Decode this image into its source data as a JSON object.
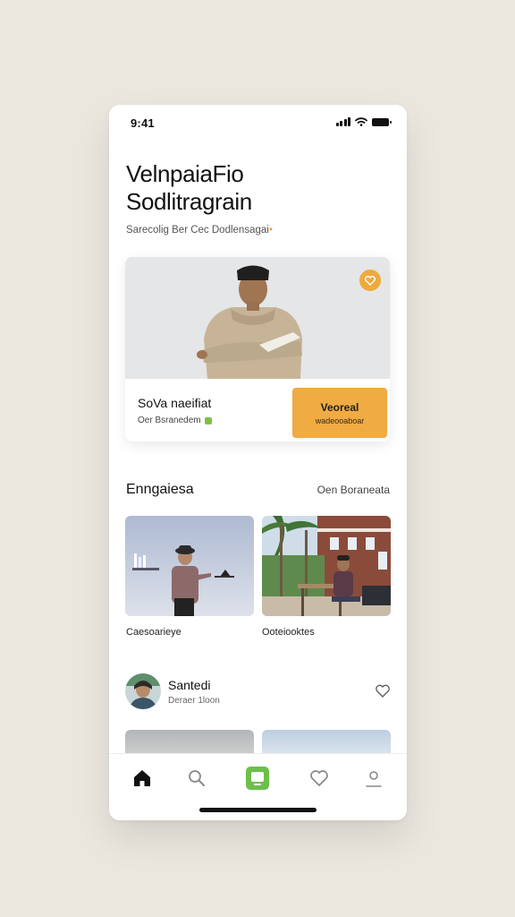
{
  "status_bar": {
    "time": "9:41"
  },
  "header": {
    "title_line1": "VelnpaiaFio",
    "title_line2": "Sodlitragrain",
    "subtitle": "Sarecolig Ber Cec Dodlensagai",
    "subtitle_accent": "•"
  },
  "hero": {
    "name": "SoVa naeifiat",
    "subtitle": "Oer Bsranedem",
    "button_label": "Veoreal",
    "button_sublabel": "wadeooaboar",
    "favorite_icon": "heart-icon"
  },
  "section": {
    "title": "Enngaiesa",
    "link": "Oen Boraneata"
  },
  "grid": [
    {
      "label": "Caesoarieye"
    },
    {
      "label": "Ooteiooktes"
    }
  ],
  "profile": {
    "name": "Santedi",
    "subtitle": "Deraer 1loon",
    "action_icon": "heart-outline-icon"
  },
  "tabbar": {
    "items": [
      "home-icon",
      "search-icon",
      "app-icon",
      "heart-icon",
      "profile-icon"
    ],
    "active_index": 2,
    "accent": "#6cc04a"
  },
  "colors": {
    "accent_orange": "#f0ab43",
    "accent_green": "#7dc142",
    "background": "#ebe7df"
  }
}
